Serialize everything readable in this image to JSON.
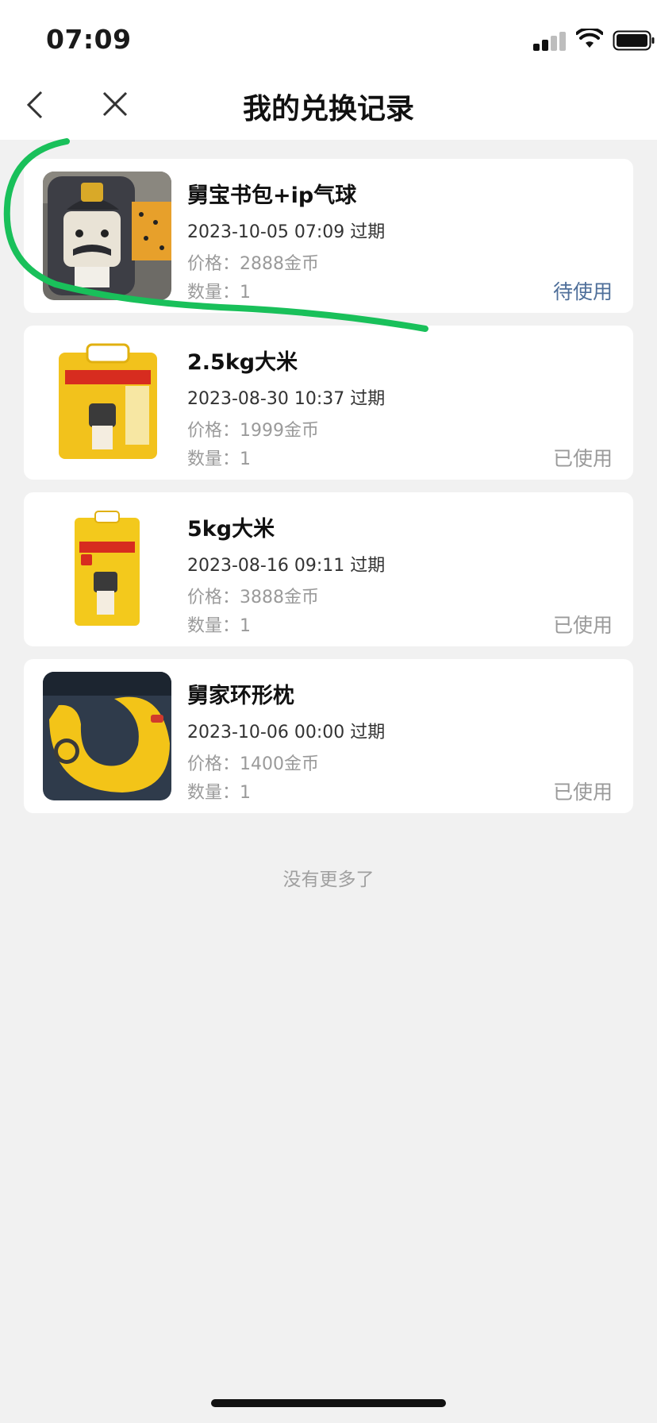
{
  "status_bar": {
    "time": "07:09"
  },
  "nav": {
    "title": "我的兑换记录"
  },
  "records": [
    {
      "title": "舅宝书包+ip气球",
      "expire": "2023-10-05 07:09 过期",
      "price": "价格：2888金币",
      "quantity": "数量：1",
      "status": "待使用",
      "status_color": "#4f6f9a"
    },
    {
      "title": "2.5kg大米",
      "expire": "2023-08-30 10:37 过期",
      "price": "价格：1999金币",
      "quantity": "数量：1",
      "status": "已使用",
      "status_color": "#9a9a9a"
    },
    {
      "title": "5kg大米",
      "expire": "2023-08-16 09:11 过期",
      "price": "价格：3888金币",
      "quantity": "数量：1",
      "status": "已使用",
      "status_color": "#9a9a9a"
    },
    {
      "title": "舅家环形枕",
      "expire": "2023-10-06 00:00 过期",
      "price": "价格：1400金币",
      "quantity": "数量：1",
      "status": "已使用",
      "status_color": "#9a9a9a"
    }
  ],
  "footer": {
    "no_more": "没有更多了"
  },
  "colors": {
    "accent_pending": "#4f6f9a",
    "annotation_green": "#19c05a",
    "background": "#f1f1f1"
  }
}
